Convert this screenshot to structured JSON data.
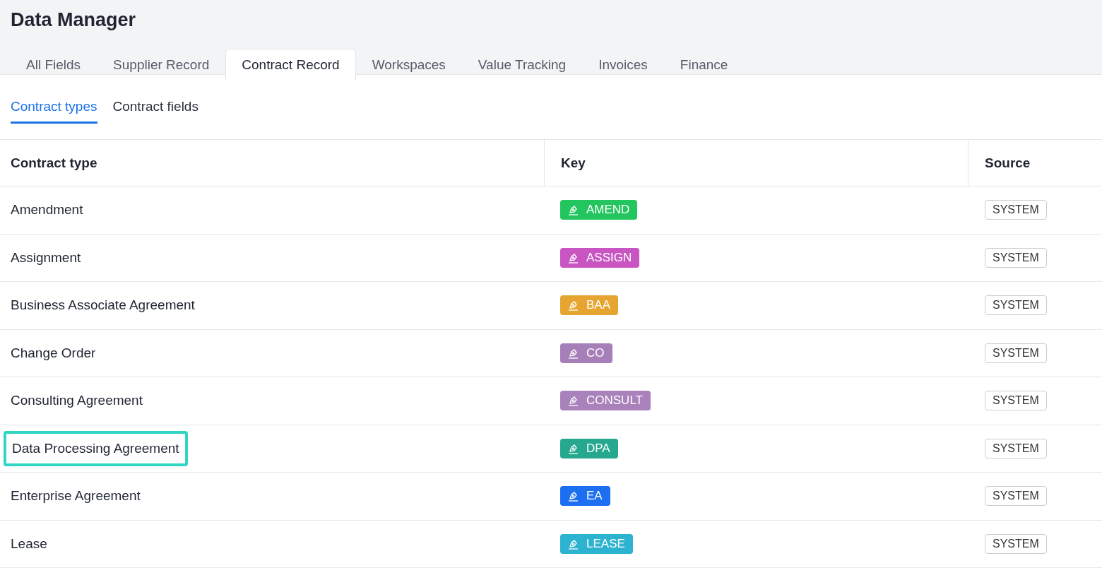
{
  "title": "Data Manager",
  "tabs": [
    {
      "label": "All Fields",
      "selected": false
    },
    {
      "label": "Supplier Record",
      "selected": false
    },
    {
      "label": "Contract Record",
      "selected": true
    },
    {
      "label": "Workspaces",
      "selected": false
    },
    {
      "label": "Value Tracking",
      "selected": false
    },
    {
      "label": "Invoices",
      "selected": false
    },
    {
      "label": "Finance",
      "selected": false
    }
  ],
  "subtabs": [
    {
      "label": "Contract types",
      "selected": true
    },
    {
      "label": "Contract fields",
      "selected": false
    }
  ],
  "table": {
    "columns": [
      "Contract type",
      "Key",
      "Source"
    ],
    "rows": [
      {
        "name": "Amendment",
        "key": "AMEND",
        "color": "#22c55e",
        "source": "SYSTEM",
        "highlighted": false
      },
      {
        "name": "Assignment",
        "key": "ASSIGN",
        "color": "#c955c3",
        "source": "SYSTEM",
        "highlighted": false
      },
      {
        "name": "Business Associate Agreement",
        "key": "BAA",
        "color": "#e5a530",
        "source": "SYSTEM",
        "highlighted": false
      },
      {
        "name": "Change Order",
        "key": "CO",
        "color": "#a77fb8",
        "source": "SYSTEM",
        "highlighted": false
      },
      {
        "name": "Consulting Agreement",
        "key": "CONSULT",
        "color": "#a982bb",
        "source": "SYSTEM",
        "highlighted": false
      },
      {
        "name": "Data Processing Agreement",
        "key": "DPA",
        "color": "#26a88e",
        "source": "SYSTEM",
        "highlighted": true
      },
      {
        "name": "Enterprise Agreement",
        "key": "EA",
        "color": "#1d6ff2",
        "source": "SYSTEM",
        "highlighted": false
      },
      {
        "name": "Lease",
        "key": "LEASE",
        "color": "#2bb3cf",
        "source": "SYSTEM",
        "highlighted": false
      }
    ]
  }
}
